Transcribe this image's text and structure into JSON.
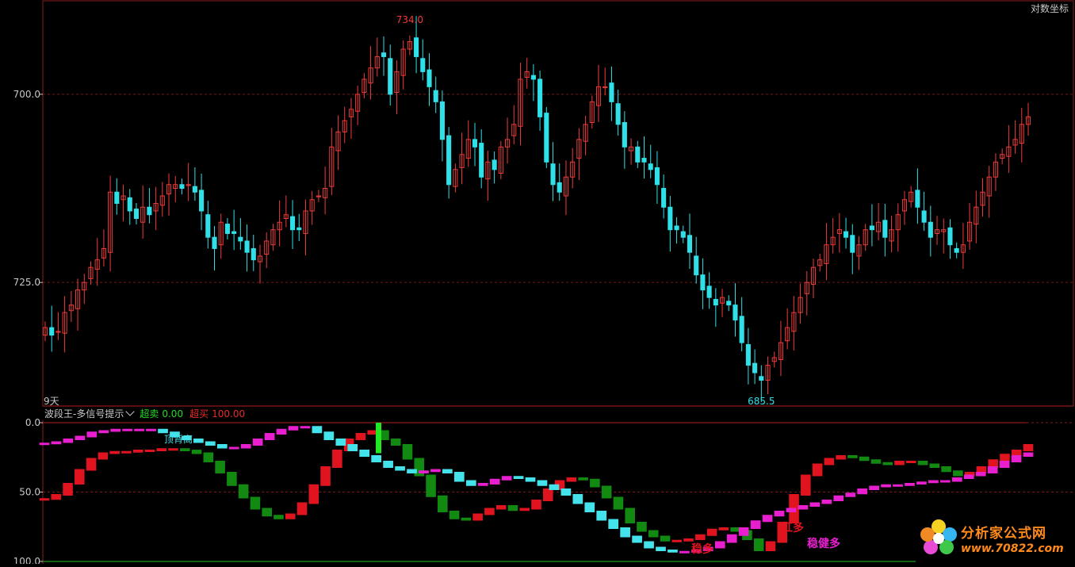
{
  "header": {
    "scale_toggle_label": "对数坐标"
  },
  "main_chart": {
    "period_label": "9天",
    "y_ticks": [
      "725.0",
      "700.0"
    ],
    "high_label": "734.0",
    "low_label": "685.5"
  },
  "indicator": {
    "name": "波段王-多信号提示",
    "oversold_label": "超卖",
    "oversold_value": "0.00",
    "overbought_label": "超买",
    "overbought_value": "100.00",
    "y_ticks": [
      "100.0",
      "50.0",
      "0.0"
    ],
    "annotations": [
      "顶背离",
      "稳多",
      "红多",
      "稳健多"
    ]
  },
  "watermark": {
    "text": "分析家公式网",
    "url": "www.70822.com"
  },
  "colors": {
    "up": "#ef3b3b",
    "down": "#2fe0e8",
    "grid": "#7a1818",
    "line_bull": "#e0141e",
    "line_bear": "#128a12",
    "line2_up": "#e81fcf",
    "line2_down": "#44e2ea",
    "signal": "#22e822"
  },
  "chart_data": [
    {
      "type": "candlestick",
      "title": "",
      "ylim": [
        684,
        737
      ],
      "y_ticks": [
        700,
        725
      ],
      "ohlc_close": [
        694,
        693,
        693.5,
        696,
        697,
        699,
        700,
        702,
        703,
        704.5,
        712,
        710.5,
        711.5,
        709.5,
        708.5,
        710,
        709,
        710.5,
        711.5,
        713,
        713,
        712.5,
        713,
        712,
        709.5,
        706,
        704.5,
        708,
        706.5,
        706.5,
        705.5,
        704,
        703,
        703.5,
        705.5,
        707,
        708,
        709,
        707,
        707,
        709.5,
        711,
        711.5,
        712.5,
        718,
        720,
        721.5,
        723,
        725,
        727,
        728.5,
        730,
        730,
        725,
        728,
        731,
        732,
        730,
        728,
        726,
        724,
        719,
        713,
        715,
        717,
        719,
        718,
        714,
        716,
        715,
        718,
        719,
        721,
        727,
        728,
        727,
        722,
        716,
        713,
        712,
        714,
        716,
        719,
        721,
        724,
        726,
        726,
        724,
        721,
        718,
        718,
        716,
        716,
        715,
        713,
        710,
        707,
        707,
        706,
        704,
        701,
        699,
        698,
        697,
        698,
        697,
        695,
        692,
        689,
        688,
        687,
        689,
        690,
        692,
        694,
        696,
        698,
        700,
        702,
        703,
        705,
        706,
        707,
        706,
        704,
        705,
        707,
        707,
        708,
        706,
        707,
        709,
        711,
        712,
        710,
        708,
        706,
        707,
        707,
        705,
        704,
        705,
        708,
        710,
        712,
        714,
        716,
        717,
        718,
        719,
        721,
        722
      ]
    },
    {
      "type": "line",
      "title": "",
      "ylim": [
        0,
        100
      ],
      "y_ticks": [
        0,
        50,
        100
      ],
      "series": [
        {
          "values": [
            45,
            48,
            56,
            66,
            74,
            78,
            79,
            79,
            80,
            80,
            81,
            81,
            80,
            78,
            72,
            64,
            55,
            46,
            38,
            33,
            31,
            34,
            42,
            55,
            68,
            80,
            88,
            92,
            94,
            88,
            84,
            74,
            62,
            47,
            36,
            31,
            30,
            34,
            38,
            40,
            37,
            38,
            44,
            52,
            58,
            60,
            59,
            54,
            46,
            38,
            28,
            22,
            18,
            15,
            15,
            16,
            19,
            23,
            24,
            22,
            16,
            8,
            14,
            28,
            48,
            62,
            70,
            74,
            76,
            75,
            73,
            71,
            70,
            72,
            72,
            70,
            68,
            65,
            62,
            64,
            68,
            73,
            77,
            80,
            84
          ]
        },
        {
          "values": [
            85,
            86,
            88,
            90,
            93,
            94,
            95,
            95,
            95,
            95,
            93,
            90,
            88,
            86,
            84,
            82,
            82,
            84,
            88,
            92,
            95,
            97,
            97,
            93,
            88,
            84,
            80,
            76,
            72,
            68,
            66,
            64,
            65,
            66,
            64,
            58,
            55,
            56,
            59,
            61,
            60,
            58,
            55,
            52,
            48,
            42,
            36,
            30,
            24,
            18,
            14,
            10,
            8,
            7,
            7,
            8,
            10,
            14,
            19,
            24,
            29,
            33,
            36,
            38,
            40,
            42,
            44,
            47,
            49,
            52,
            54,
            55,
            55,
            56,
            57,
            58,
            58,
            60,
            62,
            64,
            68,
            72,
            76,
            78
          ]
        }
      ]
    }
  ]
}
